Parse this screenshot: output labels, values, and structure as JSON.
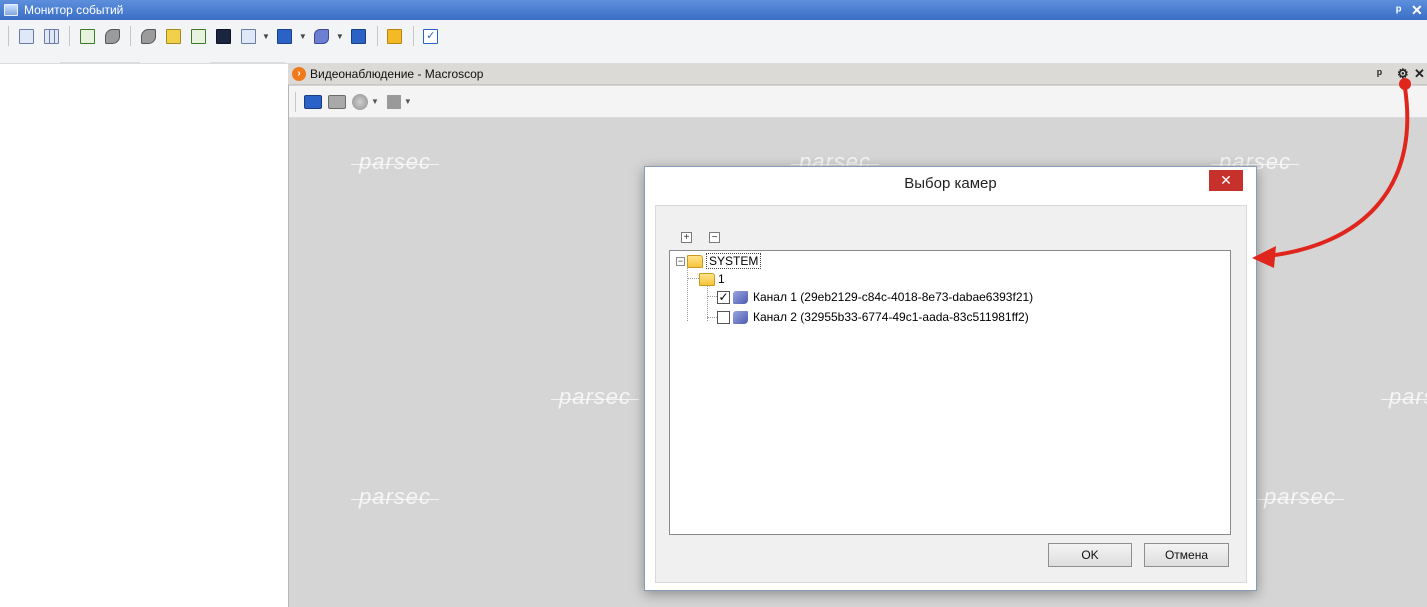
{
  "window": {
    "title": "Монитор событий",
    "pin": "ᵖ",
    "close": "✕"
  },
  "video_panel": {
    "title": "Видеонаблюдение - Macroscop",
    "pin": "ᵖ",
    "settings": "⚙",
    "close": "✕",
    "watermark": "parsec"
  },
  "dialog": {
    "title": "Выбор камер",
    "close": "✕",
    "expand_all": "+",
    "collapse_all": "−",
    "tree": {
      "root": {
        "label": "SYSTEM",
        "toggle": "−"
      },
      "folder": {
        "label": "1"
      },
      "channels": [
        {
          "label": "Канал 1 (29eb2129-c84c-4018-8e73-dabae6393f21)",
          "checked": true,
          "mark": "✓"
        },
        {
          "label": "Канал 2 (32955b33-6774-49c1-aada-83c511981ff2)",
          "checked": false,
          "mark": ""
        }
      ]
    },
    "ok_label": "OK",
    "cancel_label": "Отмена"
  },
  "colors": {
    "titlebar": "#3a6fc6",
    "dialog_close": "#c7312c",
    "arrow": "#e0261c"
  }
}
